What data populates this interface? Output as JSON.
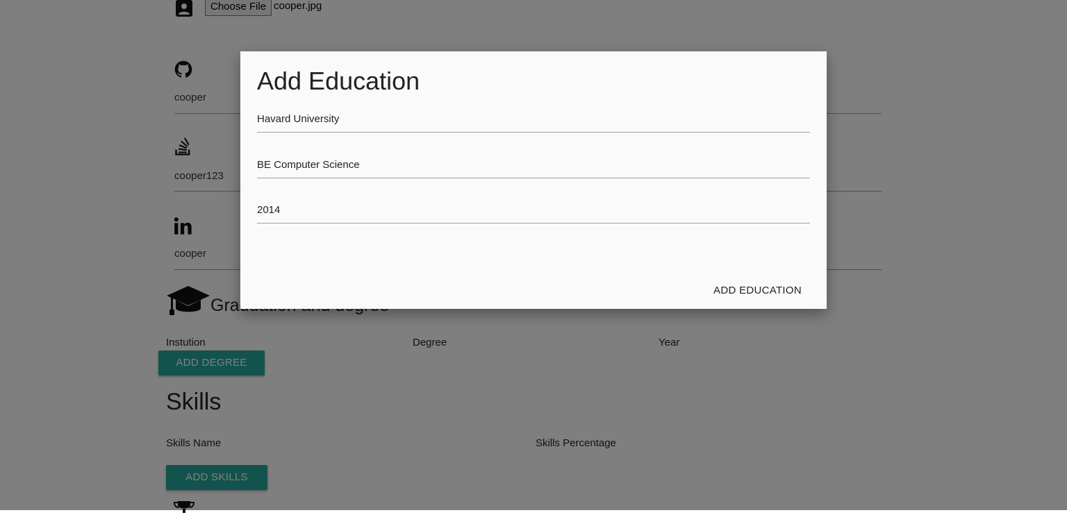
{
  "profile": {
    "file_button_label": "Choose File",
    "file_name": "cooper.jpg"
  },
  "social": [
    {
      "icon": "github-icon",
      "value": "cooper"
    },
    {
      "icon": "stackoverflow-icon",
      "value": "cooper123"
    },
    {
      "icon": "linkedin-icon",
      "value": "cooper"
    }
  ],
  "education": {
    "section_title": "Graduation and degree",
    "columns": [
      "Instution",
      "Degree",
      "Year"
    ],
    "add_button_label": "ADD DEGREE"
  },
  "skills": {
    "title": "Skills",
    "columns": [
      "Skills Name",
      "Skills Percentage"
    ],
    "add_button_label": "ADD SKILLS"
  },
  "modal": {
    "title": "Add Education",
    "fields": [
      {
        "value": "Havard University"
      },
      {
        "value": "BE Computer Science"
      },
      {
        "value": "2014"
      }
    ],
    "action_label": "ADD EDUCATION"
  },
  "colors": {
    "accent": "#26a69a",
    "overlay": "rgba(0,0,0,0.5)"
  }
}
